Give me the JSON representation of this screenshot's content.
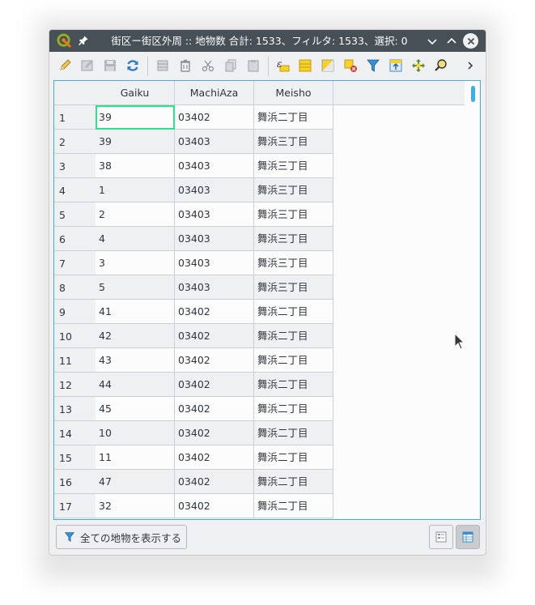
{
  "window": {
    "title": "街区ー街区外周 :: 地物数 合計: 1533、フィルタ: 1533、選択: 0"
  },
  "toolbar": {
    "icons": [
      "pencil-icon",
      "multi-edit-icon",
      "save-edits-icon",
      "reload-icon",
      "add-feature-icon",
      "delete-feature-icon",
      "cut-icon",
      "copy-icon",
      "paste-icon",
      "expression-select-icon",
      "select-all-icon",
      "invert-selection-icon",
      "deselect-icon",
      "filter-icon",
      "move-to-top-icon",
      "pan-to-selection-icon",
      "zoom-to-selection-icon",
      "more-chevron-icon"
    ]
  },
  "table": {
    "columns": [
      "Gaiku",
      "MachiAza",
      "Meisho"
    ],
    "rows": [
      {
        "n": "1",
        "gaiku": "39",
        "machiaza": "03402",
        "meisho": "舞浜二丁目"
      },
      {
        "n": "2",
        "gaiku": "39",
        "machiaza": "03403",
        "meisho": "舞浜三丁目"
      },
      {
        "n": "3",
        "gaiku": "38",
        "machiaza": "03403",
        "meisho": "舞浜三丁目"
      },
      {
        "n": "4",
        "gaiku": "1",
        "machiaza": "03403",
        "meisho": "舞浜三丁目"
      },
      {
        "n": "5",
        "gaiku": "2",
        "machiaza": "03403",
        "meisho": "舞浜三丁目"
      },
      {
        "n": "6",
        "gaiku": "4",
        "machiaza": "03403",
        "meisho": "舞浜三丁目"
      },
      {
        "n": "7",
        "gaiku": "3",
        "machiaza": "03403",
        "meisho": "舞浜三丁目"
      },
      {
        "n": "8",
        "gaiku": "5",
        "machiaza": "03403",
        "meisho": "舞浜三丁目"
      },
      {
        "n": "9",
        "gaiku": "41",
        "machiaza": "03402",
        "meisho": "舞浜二丁目"
      },
      {
        "n": "10",
        "gaiku": "42",
        "machiaza": "03402",
        "meisho": "舞浜二丁目"
      },
      {
        "n": "11",
        "gaiku": "43",
        "machiaza": "03402",
        "meisho": "舞浜二丁目"
      },
      {
        "n": "12",
        "gaiku": "44",
        "machiaza": "03402",
        "meisho": "舞浜二丁目"
      },
      {
        "n": "13",
        "gaiku": "45",
        "machiaza": "03402",
        "meisho": "舞浜二丁目"
      },
      {
        "n": "14",
        "gaiku": "10",
        "machiaza": "03402",
        "meisho": "舞浜二丁目"
      },
      {
        "n": "15",
        "gaiku": "11",
        "machiaza": "03402",
        "meisho": "舞浜二丁目"
      },
      {
        "n": "16",
        "gaiku": "47",
        "machiaza": "03402",
        "meisho": "舞浜二丁目"
      },
      {
        "n": "17",
        "gaiku": "32",
        "machiaza": "03402",
        "meisho": "舞浜二丁目"
      }
    ]
  },
  "footer": {
    "show_all_label": "全ての地物を表示する"
  },
  "colors": {
    "titlebar": "#475057",
    "accent": "#3daee9",
    "current_cell": "#2ee08b"
  }
}
